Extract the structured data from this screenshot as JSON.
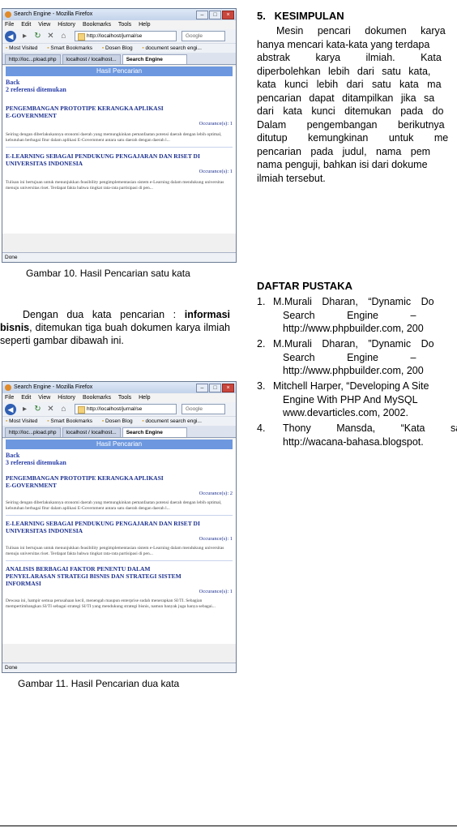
{
  "fig10": {
    "window_title": "Search Engine - Mozilla Firefox",
    "menu": [
      "File",
      "Edit",
      "View",
      "History",
      "Bookmarks",
      "Tools",
      "Help"
    ],
    "url": "http://localhost/jurnal/se",
    "search_engine": "Google",
    "bookmarks": [
      "Most Visited",
      "Smart Bookmarks",
      "Dosen Blog",
      "document search engi..."
    ],
    "tabs": [
      "http://loc...pload.php",
      "localhost / localhost...",
      "Search Engine"
    ],
    "header": "Hasil Pencarian",
    "back": "Back",
    "count": "2 referensi ditemukan",
    "results": [
      {
        "title": "PENGEMBANGAN PROTOTIPE KERANGKA APLIKASI E-GOVERNMENT",
        "occ": "Occurance(s): 1",
        "snippet": "Seiring dengan diberlakukannya otonomi daerah yang memungkinkan pemanfaatan potensi daerah dengan lebih optimal, kebutuhan berbagai fitur dalam aplikasi E-Government antara satu daerah dengan daerah l..."
      },
      {
        "title": "E-LEARNING SEBAGAI PENDUKUNG PENGAJARAN DAN RISET DI UNIVERSITAS INDONESIA",
        "occ": "Occurance(s): 1",
        "snippet": "Tulisan ini bertujuan untuk menunjukkan feasibility pengimplementasian sistem e-Learning dalam mendukung universitas menuju universitas riset. Terdapat fakta bahwa tingkat rata-rata partisipasi di pen..."
      }
    ],
    "status": "Done",
    "caption": "Gambar 10. Hasil Pencarian satu kata"
  },
  "intro_para": {
    "pre": "Dengan dua kata pencarian : ",
    "keyword": "informasi bisnis",
    "post": ", ditemukan tiga buah dokumen karya ilmiah seperti gambar dibawah ini."
  },
  "fig11": {
    "window_title": "Search Engine - Mozilla Firefox",
    "menu": [
      "File",
      "Edit",
      "View",
      "History",
      "Bookmarks",
      "Tools",
      "Help"
    ],
    "url": "http://localhost/jurnal/se",
    "search_engine": "Google",
    "bookmarks": [
      "Most Visited",
      "Smart Bookmarks",
      "Dosen Blog",
      "document search engi..."
    ],
    "tabs": [
      "http://loc...pload.php",
      "localhost / localhost...",
      "Search Engine"
    ],
    "header": "Hasil Pencarian",
    "back": "Back",
    "count": "3 referensi ditemukan",
    "results": [
      {
        "title": "PENGEMBANGAN PROTOTIPE KERANGKA APLIKASI E-GOVERNMENT",
        "occ": "Occurance(s): 2",
        "snippet": "Seiring dengan diberlakukannya otonomi daerah yang memungkinkan pemanfaatan potensi daerah dengan lebih optimal, kebutuhan berbagai fitur dalam aplikasi E-Government antara satu daerah dengan daerah l..."
      },
      {
        "title": "E-LEARNING SEBAGAI PENDUKUNG PENGAJARAN DAN RISET DI UNIVERSITAS INDONESIA",
        "occ": "Occurance(s): 1",
        "snippet": "Tulisan ini bertujuan untuk menunjukkan feasibility pengimplementasian sistem e-Learning dalam mendukung universitas menuju universitas riset. Terdapat fakta bahwa tingkat rata-rata partisipasi di pen..."
      },
      {
        "title": "ANALISIS BERBAGAI FAKTOR PENENTU DALAM PENYELARASAN STRATEGI BISNIS DAN STRATEGI SISTEM INFORMASI",
        "occ": "Occurance(s): 1",
        "snippet": "Dewasa ini, hampir semua perusahaan kecil, menengah maupun enterprise sudah menerapkan SI/TI. Sebagian mempertimbangkan SI/TI sebagai strategi SI/TI yang mendukung strategi bisnis, namun banyak juga hanya sebagai..."
      }
    ],
    "status": "Done",
    "caption": "Gambar 11. Hasil Pencarian dua kata"
  },
  "section5": {
    "heading": "5.   KESIMPULAN",
    "lines": [
      "Mesin pencari dokumen karya",
      "hanya mencari kata-kata yang terdapa",
      "abstrak karya ilmiah. Kata",
      "diperbolehkan lebih dari satu kata,",
      "kata kunci lebih dari satu kata ma",
      "pencarian dapat ditampilkan jika sa",
      "dari kata kunci ditemukan pada do",
      "Dalam pengembangan berikutnya",
      "ditutup kemungkinan untuk me",
      "pencarian pada judul, nama pem",
      "nama penguji, bahkan isi dari dokume",
      "ilmiah tersebut."
    ]
  },
  "references": {
    "heading": "DAFTAR PUSTAKA",
    "items": [
      {
        "num": "1.",
        "lines": [
          "M.Murali Dharan, “Dynamic Do",
          "Search Engine –",
          "http://www.phpbuilder.com, 200"
        ]
      },
      {
        "num": "2.",
        "lines": [
          "M.Murali Dharan, ”Dynamic Do",
          "Search Engine –",
          "http://www.phpbuilder.com, 200"
        ]
      },
      {
        "num": "3.",
        "lines": [
          "Mitchell Harper, “Developing A Site",
          "Engine With PHP And MySQL",
          "www.devarticles.com, 2002."
        ]
      },
      {
        "num": "4.",
        "lines": [
          "Thony Mansda, “Kata sa",
          "http://wacana-bahasa.blogspot."
        ]
      }
    ]
  }
}
